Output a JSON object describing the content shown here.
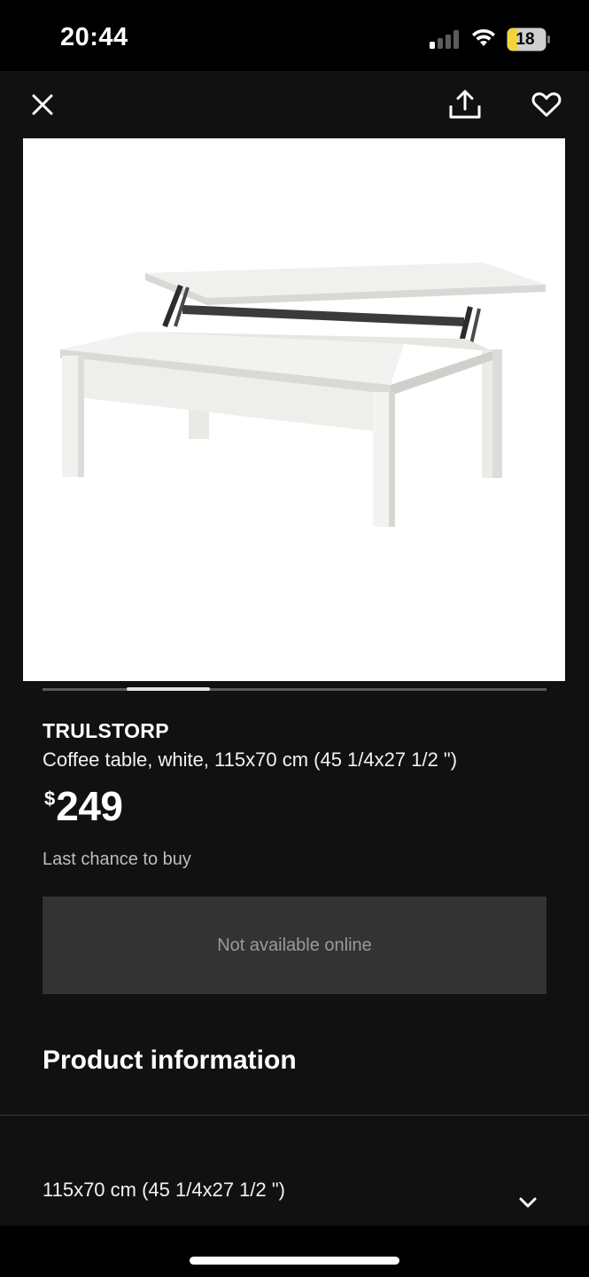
{
  "status_bar": {
    "time": "20:44",
    "battery": "18"
  },
  "toolbar": {
    "close_icon": "close-icon",
    "share_icon": "share-icon",
    "favorite_icon": "heart-icon"
  },
  "carousel": {
    "active_index": 1,
    "total": 6
  },
  "product": {
    "name": "TRULSTORP",
    "description": "Coffee table, white, 115x70 cm (45 1/4x27 1/2 \")",
    "currency_symbol": "$",
    "price": "249",
    "availability_note": "Last chance to buy",
    "cta_label": "Not available online"
  },
  "sections": {
    "product_info_title": "Product information",
    "dimension_row_label": "115x70 cm (45 1/4x27 1/2 \")"
  },
  "colors": {
    "background": "#111111",
    "button_disabled": "#333333",
    "button_text_disabled": "#9a9a9a",
    "battery_fill": "#f3d33b"
  }
}
